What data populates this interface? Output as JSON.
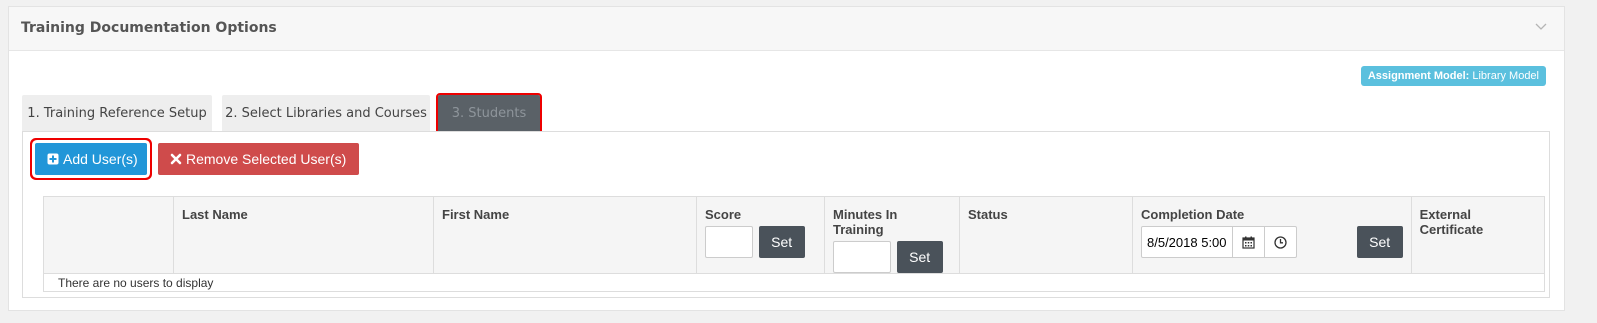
{
  "panel": {
    "title": "Training Documentation Options",
    "collapse_icon": "chevron-down-icon"
  },
  "badge": {
    "label": "Assignment Model:",
    "value": "Library Model",
    "color": "#5bc0de"
  },
  "tabs": [
    {
      "label": "1. Training Reference Setup",
      "active": false
    },
    {
      "label": "2. Select Libraries and Courses",
      "active": false
    },
    {
      "label": "3. Students",
      "active": true
    }
  ],
  "actions": {
    "add_label": "Add User(s)",
    "add_icon": "plus-square-icon",
    "remove_label": "Remove Selected User(s)",
    "remove_icon": "close-icon"
  },
  "table": {
    "columns": [
      {
        "label": ""
      },
      {
        "label": "Last Name"
      },
      {
        "label": "First Name"
      },
      {
        "label": "Score"
      },
      {
        "label": "Minutes In Training"
      },
      {
        "label": "Status"
      },
      {
        "label": "Completion Date"
      },
      {
        "label": "External Certificate"
      }
    ],
    "score_filter": {
      "value": "",
      "set_label": "Set"
    },
    "minutes_filter": {
      "value": "",
      "set_label": "Set"
    },
    "date_filter": {
      "value": "8/5/2018 5:00",
      "calendar_icon": "calendar-icon",
      "clock_icon": "clock-icon",
      "set_label": "Set"
    },
    "empty_message": "There are no users to display"
  },
  "colors": {
    "primary": "#2196d8",
    "danger": "#cf4b4b",
    "dark_button": "#4a525a",
    "active_tab": "#5a6167",
    "highlight": "#e00000"
  }
}
